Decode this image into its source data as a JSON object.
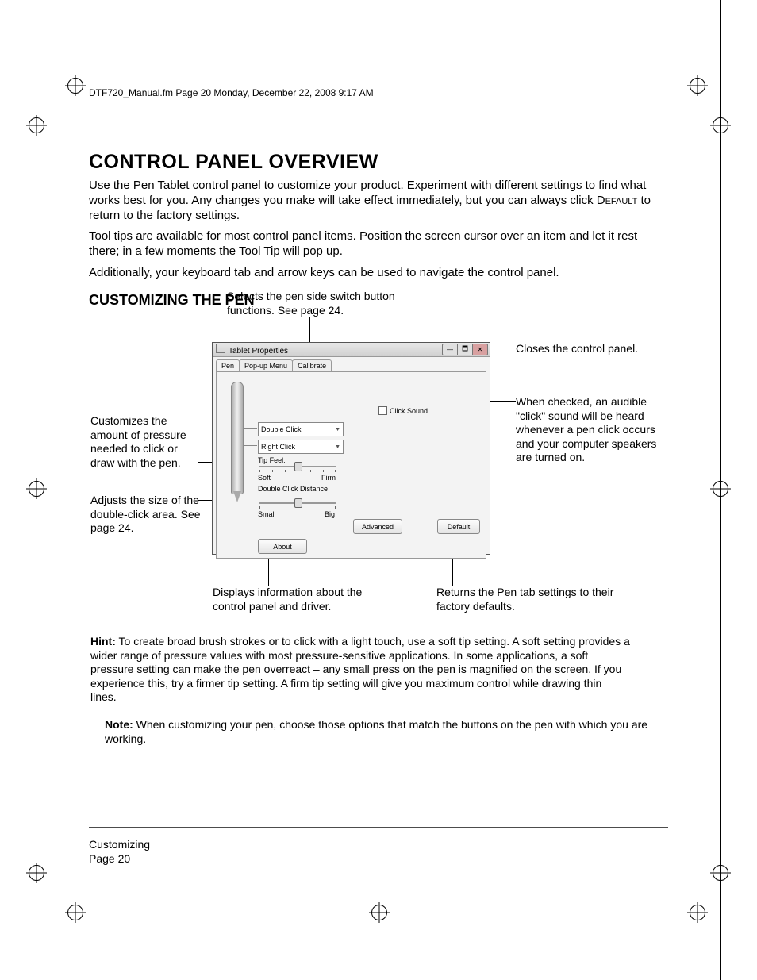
{
  "header": {
    "running": "DTF720_Manual.fm  Page 20  Monday, December 22, 2008  9:17 AM"
  },
  "headings": {
    "h1": "CONTROL PANEL OVERVIEW",
    "h2": "CUSTOMIZING THE PEN"
  },
  "paragraphs": {
    "p1a": "Use the Pen Tablet control panel to customize your product.  Experiment with different settings to find what works best for you.  Any changes you make will take effect immediately, but you can always click ",
    "p1b": "Default",
    "p1c": " to return to the factory settings.",
    "p2": "Tool tips are available for most control panel items.  Position the screen cursor over an item and let it rest there; in a few moments the Tool Tip will pop up.",
    "p3": "Additionally, your keyboard tab and arrow keys can be used to navigate the control panel."
  },
  "callouts": {
    "top": "Selects the pen side switch button functions.  See page 24.",
    "closes": "Closes the control panel.",
    "checkSound": "When checked, an audible \"click\" sound will be heard whenever a pen click occurs and your computer speakers are turned on.",
    "tipFeel": "Customizes the amount of pressure needed to click or draw with the pen.",
    "dblDist": "Adjusts the size of the double-click area.  See page 24.",
    "about": "Displays information about the control panel and driver.",
    "defaultBtn": "Returns the Pen tab settings to their factory defaults."
  },
  "dialog": {
    "title": "Tablet Properties",
    "tabs": {
      "pen": "Pen",
      "popup": "Pop-up Menu",
      "calibrate": "Calibrate"
    },
    "clickSound": "Click Sound",
    "dd1": "Double Click",
    "dd2": "Right Click",
    "tipFeelLabel": "Tip Feel:",
    "soft": "Soft",
    "firm": "Firm",
    "dblLabel": "Double Click Distance",
    "small": "Small",
    "big": "Big",
    "advanced": "Advanced",
    "default": "Default",
    "about": "About"
  },
  "hint": {
    "label": "Hint:",
    "text": " To create broad brush strokes or to click with a light touch, use a soft tip setting.  A soft setting provides a wider range of pressure values with most pressure-sensitive applications.  In some applications, a soft pressure setting can make the pen overreact – any small press on the pen is magnified on the screen.  If you experience this, try a firmer tip setting.  A firm tip setting will give you maximum control while drawing thin lines."
  },
  "note": {
    "label": "Note:",
    "text": " When customizing your pen, choose those options that match the buttons on the pen with which you are working."
  },
  "footer": {
    "section": "Customizing",
    "page": "Page  20"
  }
}
